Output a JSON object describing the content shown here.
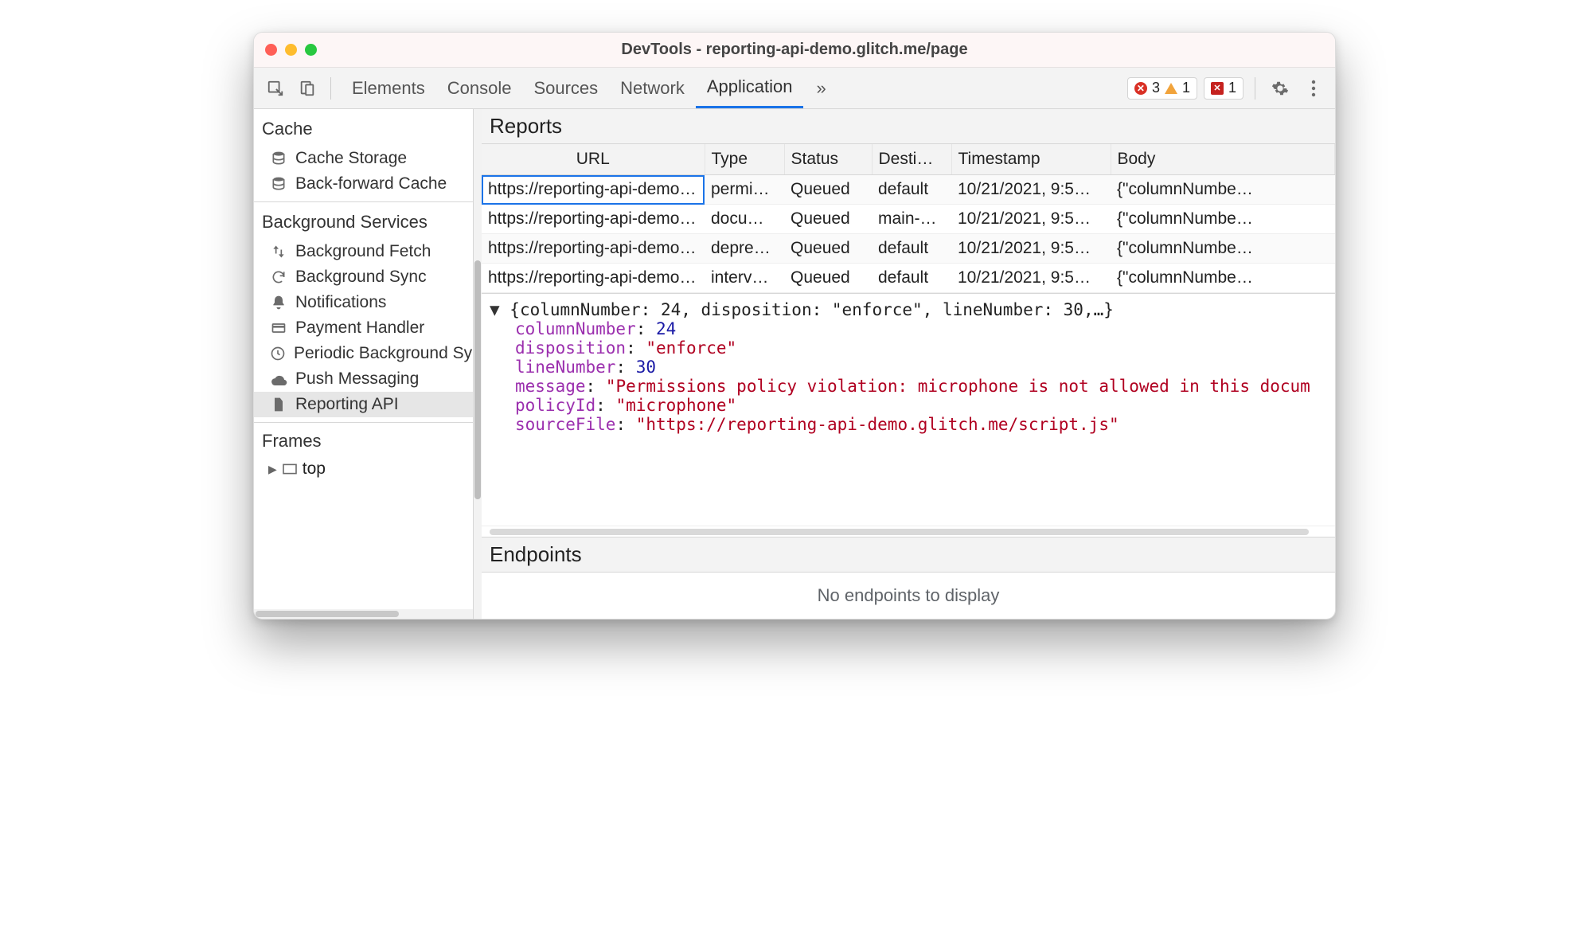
{
  "window": {
    "title": "DevTools - reporting-api-demo.glitch.me/page"
  },
  "toolbar": {
    "tabs": [
      {
        "label": "Elements",
        "active": false
      },
      {
        "label": "Console",
        "active": false
      },
      {
        "label": "Sources",
        "active": false
      },
      {
        "label": "Network",
        "active": false
      },
      {
        "label": "Application",
        "active": true
      }
    ],
    "more_tabs_indicator": "»",
    "error_count": "3",
    "warning_count": "1",
    "issue_count": "1"
  },
  "sidebar": {
    "groups": [
      {
        "title": "Cache",
        "items": [
          {
            "icon": "database-icon",
            "label": "Cache Storage"
          },
          {
            "icon": "database-icon",
            "label": "Back-forward Cache"
          }
        ]
      },
      {
        "title": "Background Services",
        "items": [
          {
            "icon": "arrows-updown-icon",
            "label": "Background Fetch"
          },
          {
            "icon": "sync-icon",
            "label": "Background Sync"
          },
          {
            "icon": "bell-icon",
            "label": "Notifications"
          },
          {
            "icon": "creditcard-icon",
            "label": "Payment Handler"
          },
          {
            "icon": "clock-icon",
            "label": "Periodic Background Sync"
          },
          {
            "icon": "cloud-icon",
            "label": "Push Messaging"
          },
          {
            "icon": "file-icon",
            "label": "Reporting API",
            "selected": true
          }
        ]
      }
    ],
    "frames": {
      "title": "Frames",
      "root": "top"
    }
  },
  "reports": {
    "panel_title": "Reports",
    "columns": [
      "URL",
      "Type",
      "Status",
      "Desti…",
      "Timestamp",
      "Body"
    ],
    "rows": [
      {
        "url": "https://reporting-api-demo…",
        "type": "permi…",
        "status": "Queued",
        "dest": "default",
        "ts": "10/21/2021, 9:5…",
        "body": "{\"columnNumbe…",
        "selected": true
      },
      {
        "url": "https://reporting-api-demo…",
        "type": "docu…",
        "status": "Queued",
        "dest": "main-…",
        "ts": "10/21/2021, 9:5…",
        "body": "{\"columnNumbe…"
      },
      {
        "url": "https://reporting-api-demo…",
        "type": "depre…",
        "status": "Queued",
        "dest": "default",
        "ts": "10/21/2021, 9:5…",
        "body": "{\"columnNumbe…"
      },
      {
        "url": "https://reporting-api-demo…",
        "type": "interv…",
        "status": "Queued",
        "dest": "default",
        "ts": "10/21/2021, 9:5…",
        "body": "{\"columnNumbe…"
      }
    ]
  },
  "detail": {
    "summary": "{columnNumber: 24, disposition: \"enforce\", lineNumber: 30,…}",
    "props": [
      {
        "key": "columnNumber",
        "val": "24",
        "type": "num"
      },
      {
        "key": "disposition",
        "val": "\"enforce\"",
        "type": "str"
      },
      {
        "key": "lineNumber",
        "val": "30",
        "type": "num"
      },
      {
        "key": "message",
        "val": "\"Permissions policy violation: microphone is not allowed in this docum",
        "type": "str"
      },
      {
        "key": "policyId",
        "val": "\"microphone\"",
        "type": "str"
      },
      {
        "key": "sourceFile",
        "val": "\"https://reporting-api-demo.glitch.me/script.js\"",
        "type": "str"
      }
    ]
  },
  "endpoints": {
    "panel_title": "Endpoints",
    "empty_text": "No endpoints to display"
  }
}
